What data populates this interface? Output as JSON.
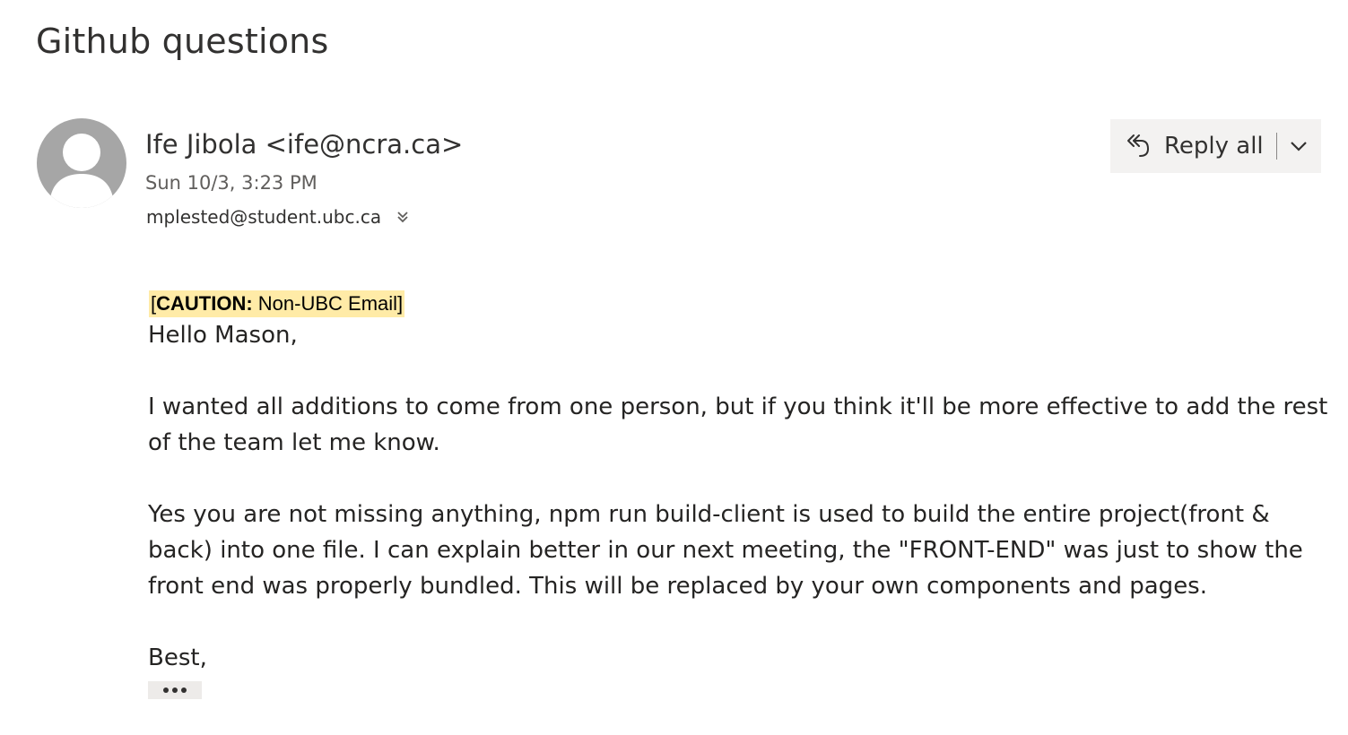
{
  "subject": "Github questions",
  "header": {
    "sender": "Ife Jibola <ife@ncra.ca>",
    "date": "Sun 10/3, 3:23 PM",
    "recipient": "mplested@student.ubc.ca",
    "avatar_icon": "person-icon",
    "expand_icon": "double-chevron-down-icon"
  },
  "actions": {
    "reply_all_label": "Reply all",
    "reply_all_icon": "reply-all-icon",
    "dropdown_icon": "chevron-down-icon"
  },
  "body": {
    "caution_open": "[",
    "caution_label": "CAUTION:",
    "caution_text": " Non-UBC Email]",
    "greeting": "Hello Mason,",
    "paragraph1": "I wanted all additions to come from one person, but if you think it'll be more effective to add the rest of the team let me know.",
    "paragraph2": "Yes you are not missing anything, npm run build-client is used to build the entire project(front & back) into one file. I can explain better in our next meeting, the \"FRONT-END\" was just to show the front end was properly bundled. This will be replaced by your own components and pages.",
    "signoff": "Best,",
    "more_icon": "ellipsis-icon"
  },
  "colors": {
    "caution_highlight": "#ffeba7",
    "avatar": "#a6a6a6",
    "button_bg": "#f3f2f1"
  }
}
